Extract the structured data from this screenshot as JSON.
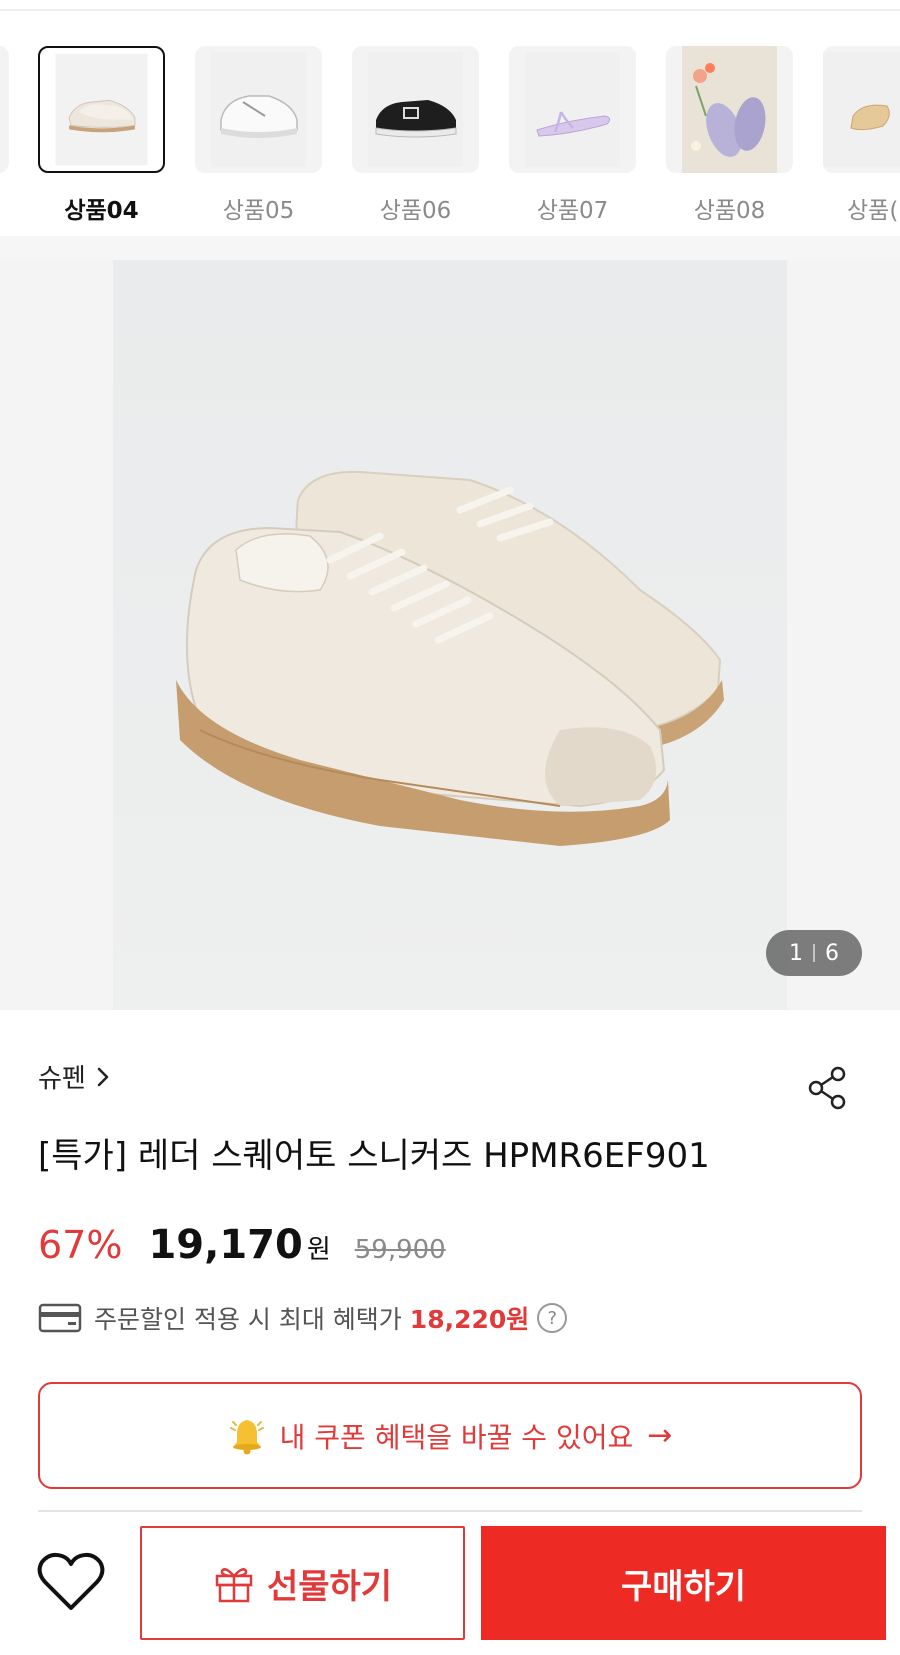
{
  "thumbnails": [
    {
      "label": "",
      "image": "partial-product-image",
      "selected": false
    },
    {
      "label": "상품04",
      "image": "beige-leather-sneakers",
      "selected": true
    },
    {
      "label": "상품05",
      "image": "white-chunky-sneakers",
      "selected": false
    },
    {
      "label": "상품06",
      "image": "black-mary-jane-sneakers",
      "selected": false
    },
    {
      "label": "상품07",
      "image": "lavender-thong-sandals",
      "selected": false
    },
    {
      "label": "상품08",
      "image": "lavender-slide-sandals",
      "selected": false
    },
    {
      "label": "상품(",
      "image": "tan-slide-sandals",
      "selected": false
    }
  ],
  "gallery": {
    "image": "beige-leather-square-toe-sneakers",
    "current": "1",
    "total": "6"
  },
  "product": {
    "brand": "슈펜",
    "title": "[특가] 레더 스퀘어토 스니커즈 HPMR6EF901",
    "discount_rate": "67%",
    "sale_price": "19,170",
    "won": "원",
    "original_price": "59,900",
    "benefit_text": "주문할인 적용 시 최대 혜택가",
    "benefit_amount": "18,220원",
    "help_icon_glyph": "?"
  },
  "coupon_banner": {
    "text": "내 쿠폰 혜택을 바꿀 수 있어요",
    "arrow": "→"
  },
  "bottom_bar": {
    "gift_label": "선물하기",
    "buy_label": "구매하기"
  },
  "colors": {
    "accent_red": "#ee2a24",
    "price_red": "#e03a3a"
  },
  "icons": [
    "chevron-right-icon",
    "share-icon",
    "card-icon",
    "help-icon",
    "bell-icon",
    "arrow-right-icon",
    "heart-icon",
    "gift-icon"
  ]
}
